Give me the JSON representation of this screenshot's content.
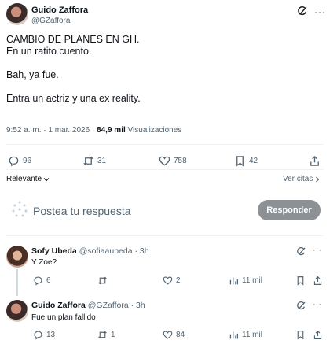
{
  "tweet": {
    "author_name": "Guido Zaffora",
    "author_handle": "@GZaffora",
    "lines": [
      "CAMBIO DE PLANES EN GH.",
      "En un ratito cuento.",
      "Bah, ya fue.",
      "Entra un actriz y una ex reality."
    ],
    "time": "9:52 a. m. · 1 mar. 2026 · ",
    "views_count": "84,9 mil",
    "views_label": " Visualizaciones",
    "stats": {
      "replies": "96",
      "retweets": "31",
      "likes": "758",
      "bookmarks": "42"
    }
  },
  "sort": {
    "relevant_label": "Relevante",
    "quotes_label": "Ver citas"
  },
  "compose": {
    "placeholder": "Postea tu respuesta",
    "button": "Responder"
  },
  "replies": [
    {
      "name": "Sofy Ubeda",
      "handle": "@sofiaaubeda",
      "time": "· 3h",
      "text": "Y Zoe?",
      "replies": "6",
      "retweets": "",
      "likes": "2",
      "views": "11 mil"
    },
    {
      "name": "Guido Zaffora",
      "handle": "@GZaffora",
      "time": "· 3h",
      "text": "Fue un plan fallido",
      "replies": "13",
      "retweets": "1",
      "likes": "84",
      "views": "11 mil"
    }
  ],
  "colors": {
    "text": "#0f1419",
    "muted": "#536471",
    "divider": "#eff3f4",
    "button_disabled": "#8c9196"
  }
}
